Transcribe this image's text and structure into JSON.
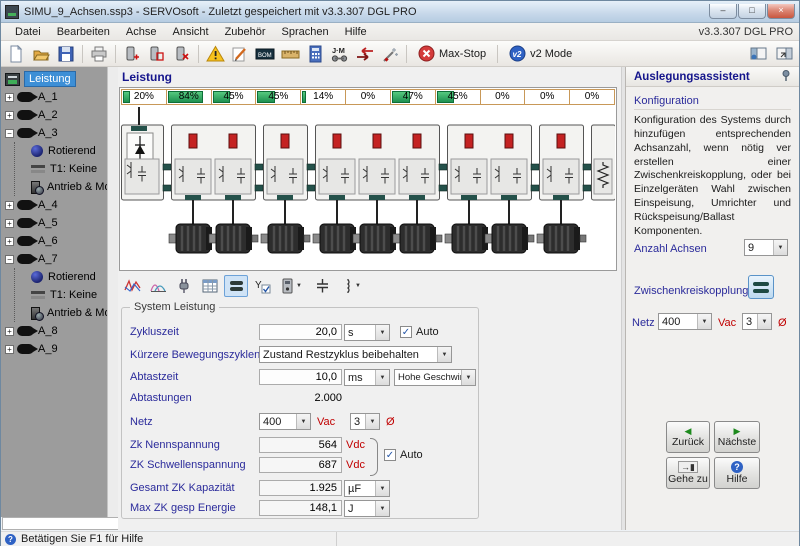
{
  "window": {
    "title": "SIMU_9_Achsen.ssp3 - SERVOsoft - Zuletzt gespeichert mit v3.3.307 DGL PRO",
    "version": "v3.3.307 DGL PRO"
  },
  "menu": {
    "items": [
      "Datei",
      "Bearbeiten",
      "Achse",
      "Ansicht",
      "Zubehör",
      "Sprachen",
      "Hilfe"
    ]
  },
  "toolbar": {
    "max_stop": "Max-Stop",
    "v2_mode": "v2 Mode",
    "bom": "BOM",
    "jm": "J·M"
  },
  "tree": {
    "root": "Leistung",
    "axes": [
      "A_1",
      "A_2",
      "A_3",
      "A_4",
      "A_5",
      "A_6",
      "A_7",
      "A_8",
      "A_9"
    ],
    "children": [
      "Rotierend",
      "T1: Keine",
      "Antrieb & Motor"
    ]
  },
  "power": {
    "header": "Leistung",
    "bar_values_pct": [
      20,
      84,
      45,
      45,
      14,
      0,
      47,
      45,
      0,
      0,
      0
    ]
  },
  "diagram": {
    "modules": [
      {
        "type": "supply"
      },
      {
        "type": "drive",
        "axes": 2
      },
      {
        "type": "drive",
        "axes": 1
      },
      {
        "type": "drive",
        "axes": 3
      },
      {
        "type": "drive",
        "axes": 2
      },
      {
        "type": "drive",
        "axes": 1
      },
      {
        "type": "ballast"
      }
    ]
  },
  "form": {
    "group_title": "System Leistung",
    "zykluszeit": {
      "label": "Zykluszeit",
      "value": "20,0",
      "unit": "s",
      "auto": "Auto"
    },
    "bewegungszyklen": {
      "label": "Kürzere Bewegungszyklen",
      "value": "Zustand Restzyklus beibehalten"
    },
    "abtastzeit": {
      "label": "Abtastzeit",
      "value": "10,0",
      "unit": "ms",
      "mode": "Hohe Geschwindigkeit"
    },
    "abtastungen": {
      "label": "Abtastungen",
      "value": "2.000"
    },
    "netz": {
      "label": "Netz",
      "value": "400",
      "unit": "Vac",
      "phase": "3",
      "phase_symbol": "Ø"
    },
    "zk_nennspannung": {
      "label": "Zk Nennspannung",
      "value": "564",
      "unit": "Vdc"
    },
    "zk_schwellenspannung": {
      "label": "ZK Schwellenspannung",
      "value": "687",
      "unit": "Vdc",
      "auto": "Auto"
    },
    "zk_kapazitaet": {
      "label": "Gesamt ZK Kapazität",
      "value": "1.925",
      "unit": "µF"
    },
    "zk_energie": {
      "label": "Max ZK gesp Energie",
      "value": "148,1",
      "unit": "J"
    }
  },
  "assistant": {
    "title": "Auslegungsassistent",
    "section": "Konfiguration",
    "description": "Konfiguration des Systems durch hinzufügen entsprechenden Achsanzahl, wenn nötig ver erstellen einer Zwischenkreiskopplung, oder bei Einzelgeräten Wahl zwischen Einspeisung, Umrichter und Rückspeisung/Ballast Komponenten.",
    "anzahl_achsen": {
      "label": "Anzahl Achsen",
      "value": "9"
    },
    "zk_label": "Zwischenkreiskopplung",
    "netz": {
      "label": "Netz",
      "value": "400",
      "unit": "Vac",
      "phase": "3",
      "phase_symbol": "Ø"
    },
    "buttons": {
      "back": "Zurück",
      "next": "Nächste",
      "goto": "Gehe zu",
      "help": "Hilfe"
    }
  },
  "statusbar": {
    "text": "Betätigen Sie F1 für Hilfe"
  }
}
